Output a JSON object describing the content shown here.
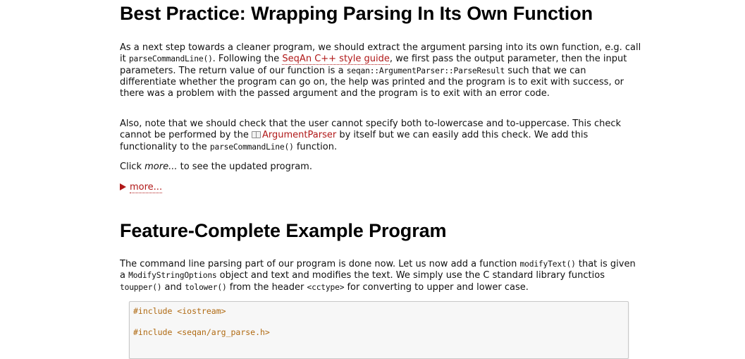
{
  "section1": {
    "title": "Best Practice: Wrapping Parsing In Its Own Function",
    "p1": {
      "t1": "As a next step towards a cleaner program, we should extract the argument parsing into its own function, e.g. call it ",
      "c1": "parseCommandLine()",
      "t2": ". Following the ",
      "link1": "SeqAn C++ style guide",
      "t3": ", we first pass the output parameter, then the input parameters. The return value of our function is a ",
      "c2": "seqan::ArgumentParser::ParseResult",
      "t4": " such that we can differentiate whether the program can go on, the help was printed and the program is to exit with success, or there was a problem with the passed argument and the program is to exit with an error code."
    },
    "p2": {
      "t1": "Also, note that we should check that the user cannot specify both to-lowercase and to-uppercase. This check cannot be performed by the ",
      "link1": "ArgumentParser",
      "t2": " by itself but we can easily add this check. We add this functionality to the ",
      "c1": "parseCommandLine()",
      "t3": " function."
    },
    "p3": {
      "t1": "Click ",
      "em1": "more...",
      "t2": " to see the updated program."
    },
    "more_label": "more..."
  },
  "section2": {
    "title": "Feature-Complete Example Program",
    "p1": {
      "t1": "The command line parsing part of our program is done now. Let us now add a function ",
      "c1": "modifyText()",
      "t2": " that is given a ",
      "c2": "ModifyStringOptions",
      "t3": " object and text and modifies the text. We simply use the C standard library functios ",
      "c3": "toupper()",
      "t4": " and ",
      "c4": "tolower()",
      "t5": " from the header ",
      "c5": "<cctype>",
      "t6": " for converting to upper and lower case."
    },
    "code_lines": [
      "#include <iostream>",
      "#include <seqan/arg_parse.h>"
    ]
  },
  "colors": {
    "link": "#b01818",
    "code_preprocessor": "#b06a12",
    "code_background": "#f7f7f7"
  }
}
